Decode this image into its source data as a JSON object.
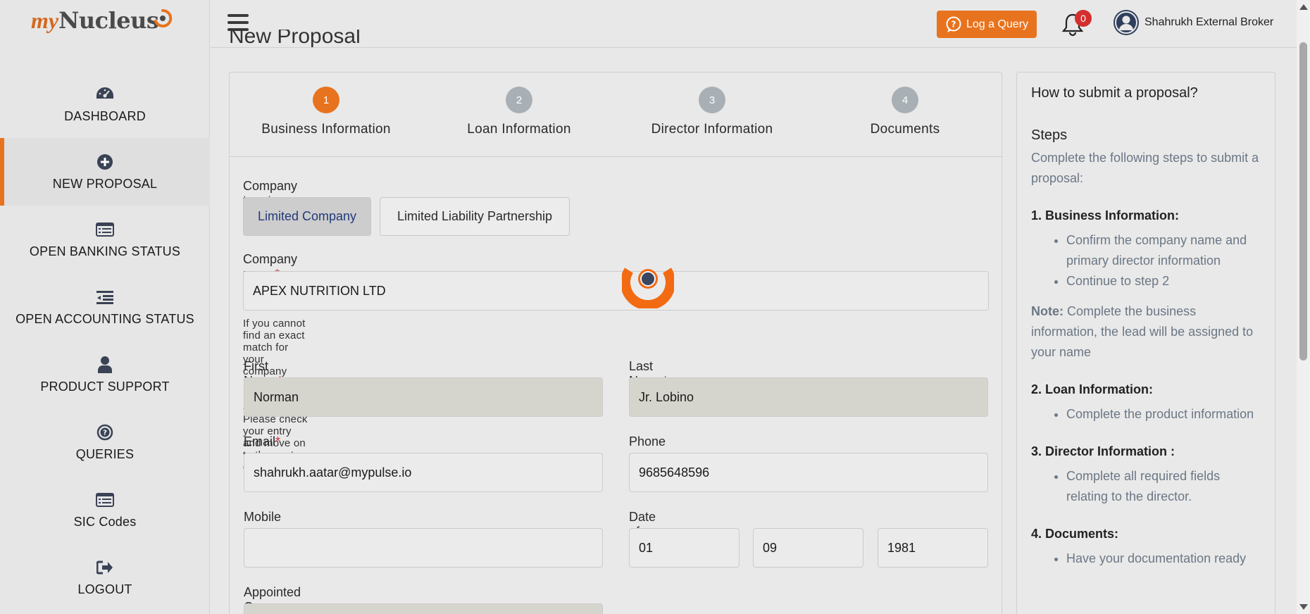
{
  "logo": {
    "my": "my",
    "nucleus": "Nucleus"
  },
  "sidebar": {
    "items": [
      {
        "label": "DASHBOARD",
        "icon": "dashboard-gauge-icon"
      },
      {
        "label": "NEW PROPOSAL",
        "icon": "plus-circle-icon",
        "active": true
      },
      {
        "label": "OPEN BANKING STATUS",
        "icon": "list-card-icon"
      },
      {
        "label": "OPEN ACCOUNTING STATUS",
        "icon": "indent-list-icon"
      },
      {
        "label": "PRODUCT SUPPORT",
        "icon": "user-icon"
      },
      {
        "label": "QUERIES",
        "icon": "question-circle-icon"
      },
      {
        "label": "SIC Codes",
        "icon": "list-card-icon"
      },
      {
        "label": "LOGOUT",
        "icon": "sign-out-icon"
      }
    ]
  },
  "topbar": {
    "log_query": "Log a Query",
    "notifications_count": "0",
    "user_name": "Shahrukh External Broker"
  },
  "page": {
    "title": "New Proposal"
  },
  "steps": [
    {
      "number": "1",
      "label": "Business Information",
      "active": true
    },
    {
      "number": "2",
      "label": "Loan Information"
    },
    {
      "number": "3",
      "label": "Director Information"
    },
    {
      "number": "4",
      "label": "Documents"
    }
  ],
  "form": {
    "company_type_label": "Company type",
    "company_type_options": [
      "Limited Company",
      "Limited Liability Partnership"
    ],
    "company_type_selected": "Limited Company",
    "company_name_label": "Company name",
    "company_name_value": "APEX NUTRITION LTD",
    "company_name_hint": "If you cannot find an exact match for your company name and information automatically. Please check your entry and move on to the next question.",
    "first_name_label": "First Name",
    "first_name_value": "Norman",
    "last_name_label": "Last Name",
    "last_name_value": "Jr. Lobino",
    "email_label": "Email",
    "email_value": "shahrukh.aatar@mypulse.io",
    "phone_label": "Phone",
    "phone_value": "9685648596",
    "mobile_label": "Mobile",
    "mobile_value": "",
    "dob_label": "Date of Birth",
    "dob_day": "01",
    "dob_month": "09",
    "dob_year": "1981",
    "appointed_label": "Appointed On",
    "required_marker": "*"
  },
  "help": {
    "title": "How to submit a proposal?",
    "steps_heading": "Steps",
    "intro": "Complete the following steps to submit a proposal:",
    "s1_title": "1. Business Information:",
    "s1_items": [
      "Confirm the company name and primary director information",
      "Continue to step 2"
    ],
    "note_label": "Note:",
    "note_text": " Complete the business information, the lead will be assigned to your name",
    "s2_title": "2. Loan Information:",
    "s2_items": [
      "Complete the product information"
    ],
    "s3_title": "3. Director Information :",
    "s3_items": [
      "Complete all required fields relating to the director."
    ],
    "s4_title": "4. Documents:",
    "s4_items": [
      "Have your documentation ready"
    ]
  },
  "colors": {
    "accent": "#e8731e",
    "badge": "#d32f2f",
    "readonly_bg": "#d6d5cd"
  }
}
